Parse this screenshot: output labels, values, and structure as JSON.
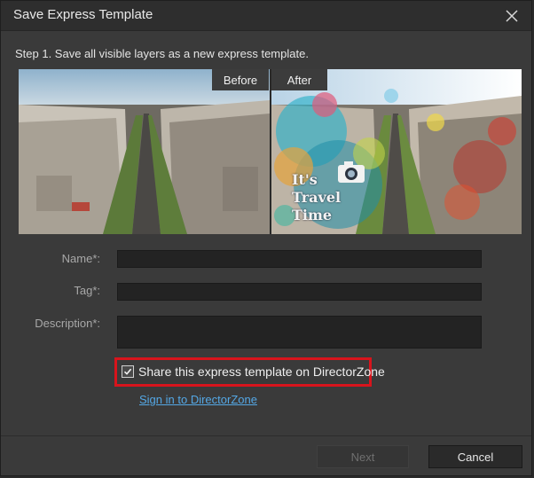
{
  "window": {
    "title": "Save Express Template"
  },
  "step_text": "Step 1. Save all visible layers as a new express template.",
  "preview": {
    "before_label": "Before",
    "after_label": "After",
    "overlay_lines": [
      "It's",
      "Travel",
      "Time"
    ]
  },
  "form": {
    "name_label": "Name*:",
    "name_value": "",
    "tag_label": "Tag*:",
    "tag_value": "",
    "description_label": "Description*:",
    "description_value": ""
  },
  "share": {
    "checked": true,
    "label": "Share this express template on DirectorZone",
    "highlight_color": "#d8141c"
  },
  "signin_link": "Sign in to DirectorZone",
  "buttons": {
    "next_label": "Next",
    "next_enabled": false,
    "cancel_label": "Cancel"
  },
  "icons": {
    "close": "close-icon",
    "checkbox": "checkmark-icon",
    "camera": "camera-icon"
  }
}
